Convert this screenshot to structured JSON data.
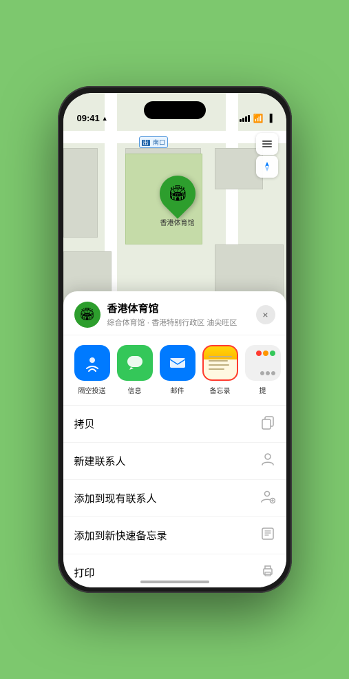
{
  "status_bar": {
    "time": "09:41",
    "location_arrow": "▲"
  },
  "map": {
    "label_text": "南口",
    "label_prefix": "出",
    "pin_label": "香港体育馆",
    "pin_emoji": "🏟"
  },
  "map_controls": {
    "layers_icon": "🗺",
    "location_icon": "⤢"
  },
  "location_header": {
    "name": "香港体育馆",
    "subtitle": "综合体育馆 · 香港特别行政区 油尖旺区",
    "close_label": "×"
  },
  "share_items": [
    {
      "label": "隔空投送",
      "type": "airdrop",
      "color": "#007aff"
    },
    {
      "label": "信息",
      "type": "messages",
      "color": "#34c759"
    },
    {
      "label": "邮件",
      "type": "mail",
      "color": "#007aff"
    },
    {
      "label": "备忘录",
      "type": "notes",
      "color": "#ffd60a",
      "selected": true
    },
    {
      "label": "提",
      "type": "more",
      "color": "#e8e8e8"
    }
  ],
  "action_items": [
    {
      "label": "拷贝",
      "icon": "copy"
    },
    {
      "label": "新建联系人",
      "icon": "person"
    },
    {
      "label": "添加到现有联系人",
      "icon": "person-add"
    },
    {
      "label": "添加到新快速备忘录",
      "icon": "note"
    },
    {
      "label": "打印",
      "icon": "print"
    }
  ]
}
